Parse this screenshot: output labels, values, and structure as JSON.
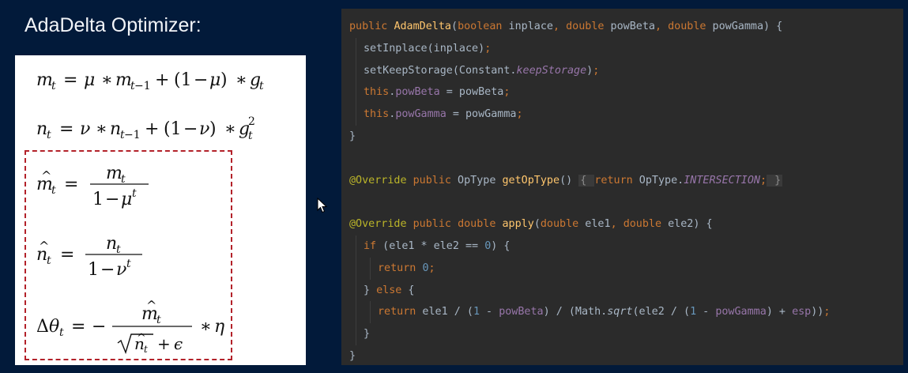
{
  "slide": {
    "title": "AdaDelta Optimizer:"
  },
  "formulas": [
    {
      "id": "m-update",
      "latex": "m_t = \\mu * m_{t-1} + (1-\\mu) * g_t"
    },
    {
      "id": "n-update",
      "latex": "n_t = \\nu * n_{t-1} + (1-\\nu) * g_t^2"
    },
    {
      "id": "m-hat",
      "latex": "\\hat{m}_t = \\frac{m_t}{1-\\mu^t}"
    },
    {
      "id": "n-hat",
      "latex": "\\hat{n}_t = \\frac{n_t}{1-\\nu^t}"
    },
    {
      "id": "delta-theta",
      "latex": "\\Delta\\theta_t = -\\frac{\\hat{m}_t}{\\sqrt{\\hat{n}_t}+\\epsilon} * \\eta"
    }
  ],
  "code": {
    "l1": {
      "t1": "public",
      "t2": " ",
      "t3": "AdamDelta",
      "t4": "(",
      "t5": "boolean",
      "t6": " inplace",
      "t7": ", ",
      "t8": "double",
      "t9": " powBeta",
      "t10": ", ",
      "t11": "double",
      "t12": " powGamma) {"
    },
    "l2": {
      "t1": "setInplace(inplace)",
      "t2": ";"
    },
    "l3": {
      "t1": "setKeepStorage(Constant.",
      "t2": "keepStorage",
      "t3": ")",
      "t4": ";"
    },
    "l4": {
      "t1": "this",
      "t2": ".",
      "t3": "powBeta",
      "t4": " = powBeta",
      "t5": ";"
    },
    "l5": {
      "t1": "this",
      "t2": ".",
      "t3": "powGamma",
      "t4": " = powGamma",
      "t5": ";"
    },
    "l6": {
      "t1": "}"
    },
    "l8": {
      "t1": "@Override",
      "t2": " ",
      "t3": "public",
      "t4": " OpType ",
      "t5": "getOpType",
      "t6": "() ",
      "t7": "{ ",
      "t8": "return",
      "t9": " OpType.",
      "t10": "INTERSECTION",
      "t11": ";",
      "t12": " }"
    },
    "l10": {
      "t1": "@Override",
      "t2": " ",
      "t3": "public",
      "t4": " ",
      "t5": "double",
      "t6": " ",
      "t7": "apply",
      "t8": "(",
      "t9": "double",
      "t10": " ele1",
      "t11": ", ",
      "t12": "double",
      "t13": " ele2) {"
    },
    "l11": {
      "t1": "if",
      "t2": " (ele1 * ele2 == ",
      "t3": "0",
      "t4": ") {"
    },
    "l12": {
      "t1": "return",
      "t2": " ",
      "t3": "0",
      "t4": ";"
    },
    "l13": {
      "t1": "} ",
      "t2": "else",
      "t3": " {"
    },
    "l14": {
      "t1": "return",
      "t2": " ele1 / (",
      "t3": "1",
      "t4": " - ",
      "t5": "powBeta",
      "t6": ") / (Math.",
      "t7": "sqrt",
      "t8": "(ele2 / (",
      "t9": "1",
      "t10": " - ",
      "t11": "powGamma",
      "t12": ") + ",
      "t13": "esp",
      "t14": "))",
      "t15": ";"
    },
    "l15": {
      "t1": "}"
    },
    "l16": {
      "t1": "}"
    }
  },
  "colors": {
    "slide_bg": "#021a3a",
    "editor_bg": "#2b2b2b",
    "keyword": "#cc7832",
    "method": "#ffc66d",
    "field": "#9876aa",
    "number": "#6897bb",
    "annotation": "#bbb529",
    "dashed_border": "#b3222a"
  },
  "icons": {
    "cursor": "mouse-pointer-icon"
  }
}
